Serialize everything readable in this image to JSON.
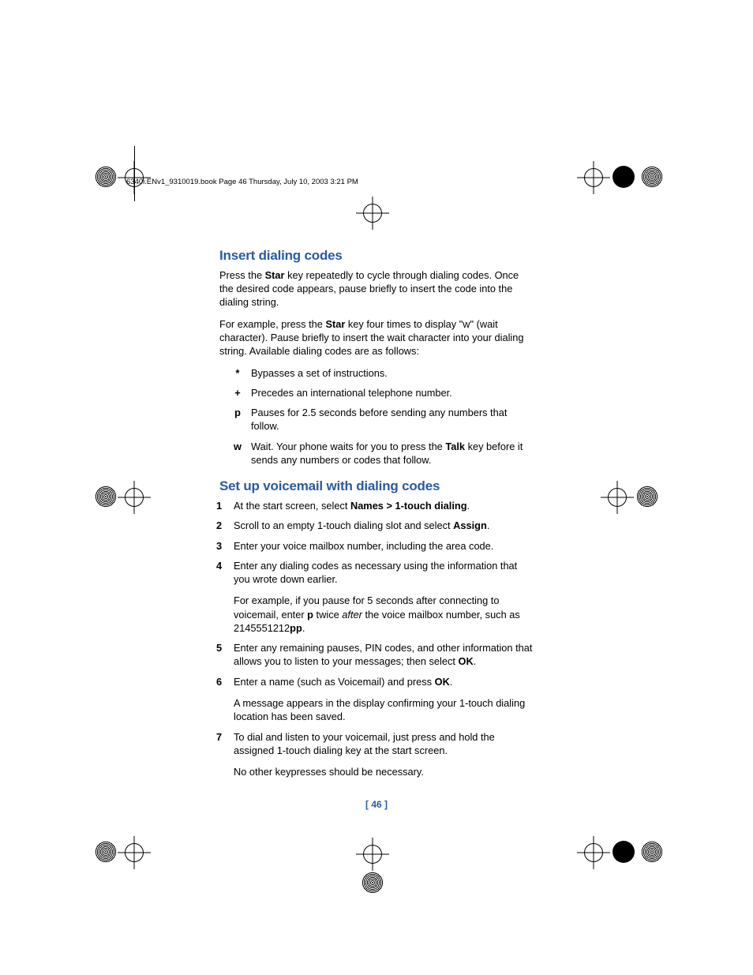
{
  "header": "6340i.ENv1_9310019.book  Page 46  Thursday, July 10, 2003  3:21 PM",
  "section1": {
    "title": "Insert dialing codes",
    "p1_a": "Press the ",
    "p1_b": "Star",
    "p1_c": " key repeatedly to cycle through dialing codes. Once the desired code appears, pause briefly to insert the code into the dialing string.",
    "p2_a": "For example, press the ",
    "p2_b": "Star",
    "p2_c": " key four times to display \"w\" (wait character). Pause briefly to insert the wait character into your dialing string. Available dialing codes are as follows:",
    "codes": [
      {
        "sym": "*",
        "text_a": "Bypasses a set of instructions."
      },
      {
        "sym": "+",
        "text_a": "Precedes an international telephone number."
      },
      {
        "sym": "p",
        "text_a": "Pauses for 2.5 seconds before sending any numbers that follow."
      },
      {
        "sym": "w",
        "text_a": "Wait. Your phone waits for you to press the ",
        "bold": "Talk",
        "text_b": " key before it sends any numbers or codes that follow."
      }
    ]
  },
  "section2": {
    "title": "Set up voicemail with dialing codes",
    "steps": [
      {
        "n": "1",
        "runs": [
          {
            "t": "At the start screen, select "
          },
          {
            "t": "Names > 1-touch dialing",
            "b": true
          },
          {
            "t": "."
          }
        ]
      },
      {
        "n": "2",
        "runs": [
          {
            "t": "Scroll to an empty 1-touch dialing slot and select "
          },
          {
            "t": "Assign",
            "b": true
          },
          {
            "t": "."
          }
        ]
      },
      {
        "n": "3",
        "runs": [
          {
            "t": "Enter your voice mailbox number, including the area code."
          }
        ]
      },
      {
        "n": "4",
        "runs": [
          {
            "t": "Enter any dialing codes as necessary using the information that you wrote down earlier."
          }
        ],
        "extra": [
          {
            "t": "For example, if you pause for 5 seconds after connecting to voicemail, enter "
          },
          {
            "t": "p",
            "b": true
          },
          {
            "t": " twice "
          },
          {
            "t": "after",
            "i": true
          },
          {
            "t": " the voice mailbox number, such as 2145551212"
          },
          {
            "t": "pp",
            "b": true
          },
          {
            "t": "."
          }
        ]
      },
      {
        "n": "5",
        "runs": [
          {
            "t": "Enter any remaining pauses, PIN codes, and other information that allows you to listen to your messages; then select "
          },
          {
            "t": "OK",
            "b": true
          },
          {
            "t": "."
          }
        ]
      },
      {
        "n": "6",
        "runs": [
          {
            "t": "Enter a name (such as Voicemail) and press "
          },
          {
            "t": "OK",
            "b": true
          },
          {
            "t": "."
          }
        ],
        "extra": [
          {
            "t": "A message appears in the display confirming your 1-touch dialing location has been saved."
          }
        ]
      },
      {
        "n": "7",
        "runs": [
          {
            "t": "To dial and listen to your voicemail, just press and hold the assigned 1-touch dialing key at the start screen."
          }
        ],
        "extra": [
          {
            "t": "No other keypresses should be necessary."
          }
        ]
      }
    ]
  },
  "page_number": "[ 46 ]"
}
